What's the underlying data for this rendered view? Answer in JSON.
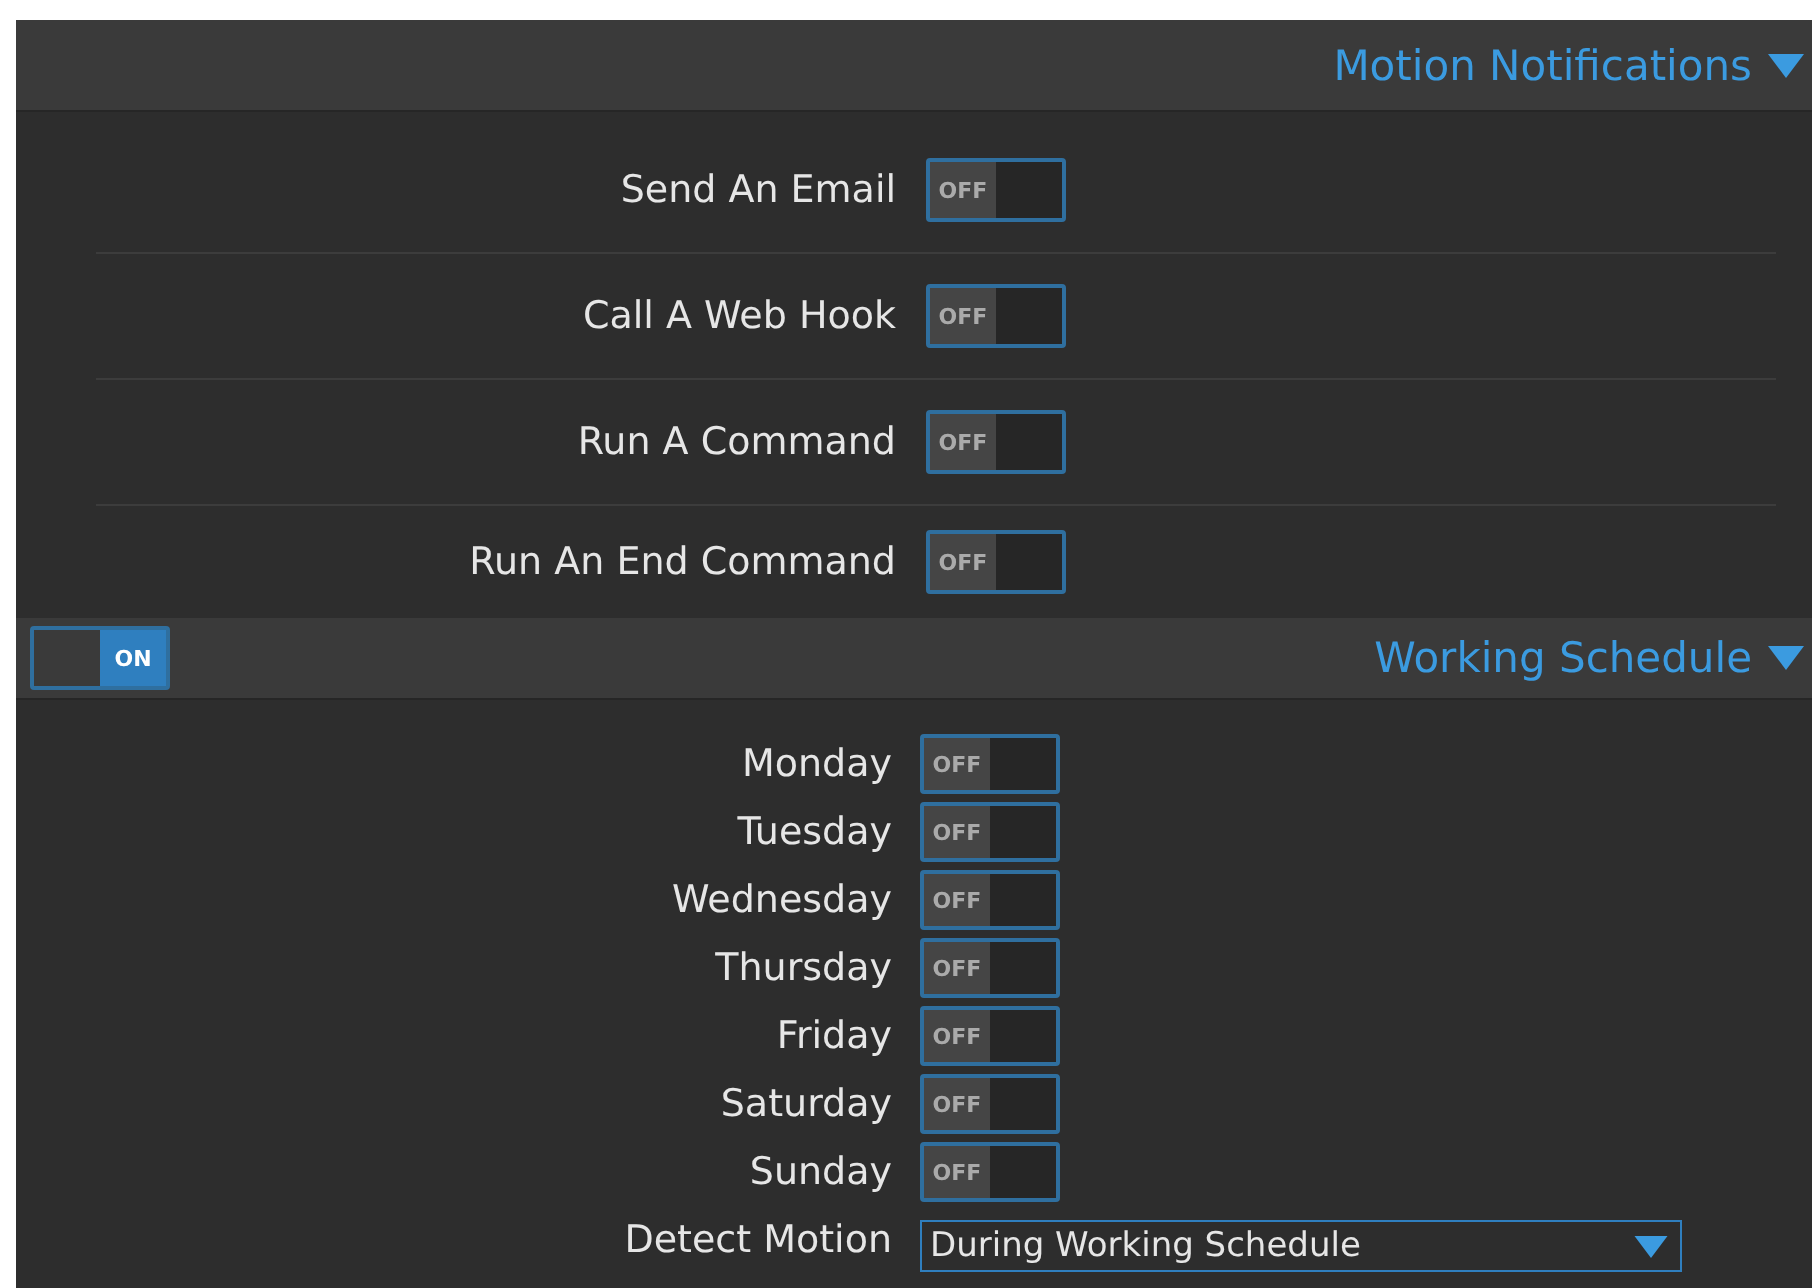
{
  "notifications": {
    "title": "Motion Notifications",
    "expanded": true,
    "rows": [
      {
        "label": "Send An Email",
        "on": false,
        "toggle_text": "OFF"
      },
      {
        "label": "Call A Web Hook",
        "on": false,
        "toggle_text": "OFF"
      },
      {
        "label": "Run A Command",
        "on": false,
        "toggle_text": "OFF"
      },
      {
        "label": "Run An End Command",
        "on": false,
        "toggle_text": "OFF"
      }
    ]
  },
  "schedule": {
    "title": "Working Schedule",
    "expanded": true,
    "on": true,
    "toggle_text": "ON",
    "days": [
      {
        "label": "Monday",
        "on": false,
        "toggle_text": "OFF"
      },
      {
        "label": "Tuesday",
        "on": false,
        "toggle_text": "OFF"
      },
      {
        "label": "Wednesday",
        "on": false,
        "toggle_text": "OFF"
      },
      {
        "label": "Thursday",
        "on": false,
        "toggle_text": "OFF"
      },
      {
        "label": "Friday",
        "on": false,
        "toggle_text": "OFF"
      },
      {
        "label": "Saturday",
        "on": false,
        "toggle_text": "OFF"
      },
      {
        "label": "Sunday",
        "on": false,
        "toggle_text": "OFF"
      }
    ],
    "detect": {
      "label": "Detect Motion",
      "value": "During Working Schedule"
    }
  }
}
